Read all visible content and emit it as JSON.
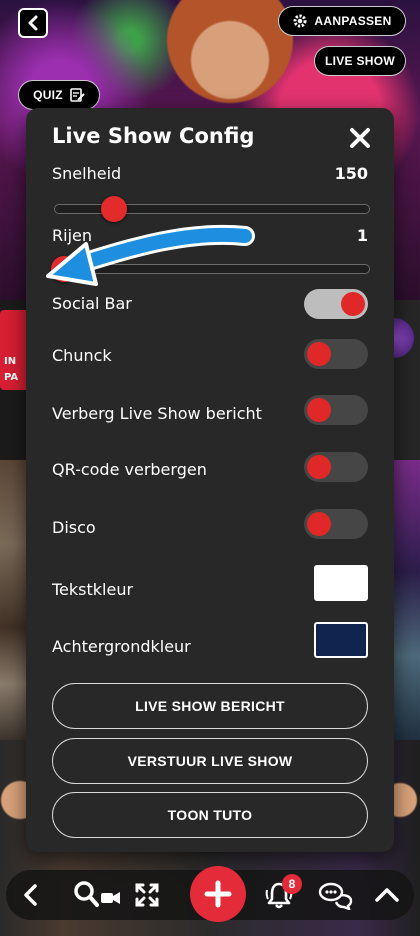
{
  "top": {
    "aanpassen_label": "AANPASSEN",
    "liveshow_label": "LIVE SHOW",
    "quiz_label": "QUIZ"
  },
  "background": {
    "card_text_1": "IN",
    "card_text_2": "PA"
  },
  "modal": {
    "title": "Live Show Config",
    "sliders": [
      {
        "label": "Snelheid",
        "value": "150",
        "fraction": 0.16
      },
      {
        "label": "Rijen",
        "value": "1",
        "fraction": 0.0
      }
    ],
    "toggles": [
      {
        "label": "Social Bar",
        "on": true
      },
      {
        "label": "Chunck",
        "on": false
      },
      {
        "label": "Verberg Live Show bericht",
        "on": false
      },
      {
        "label": "QR-code verbergen",
        "on": false
      },
      {
        "label": "Disco",
        "on": false
      }
    ],
    "colors": [
      {
        "label": "Tekstkleur",
        "color": "#ffffff"
      },
      {
        "label": "Achtergrondkleur",
        "color": "#0f2550"
      }
    ],
    "buttons": [
      "LIVE SHOW BERICHT",
      "VERSTUUR LIVE SHOW",
      "TOON TUTO"
    ]
  },
  "bottom_bar": {
    "notification_count": "8",
    "icons": [
      "chevron-left-icon",
      "search-video-icon",
      "fullscreen-icon",
      "plus-icon",
      "bell-icon",
      "chat-icon",
      "chevron-up-icon"
    ]
  },
  "colors": {
    "accent": "#e32b3a",
    "modal_bg": "#282828",
    "arrow": "#1e8fe0"
  }
}
